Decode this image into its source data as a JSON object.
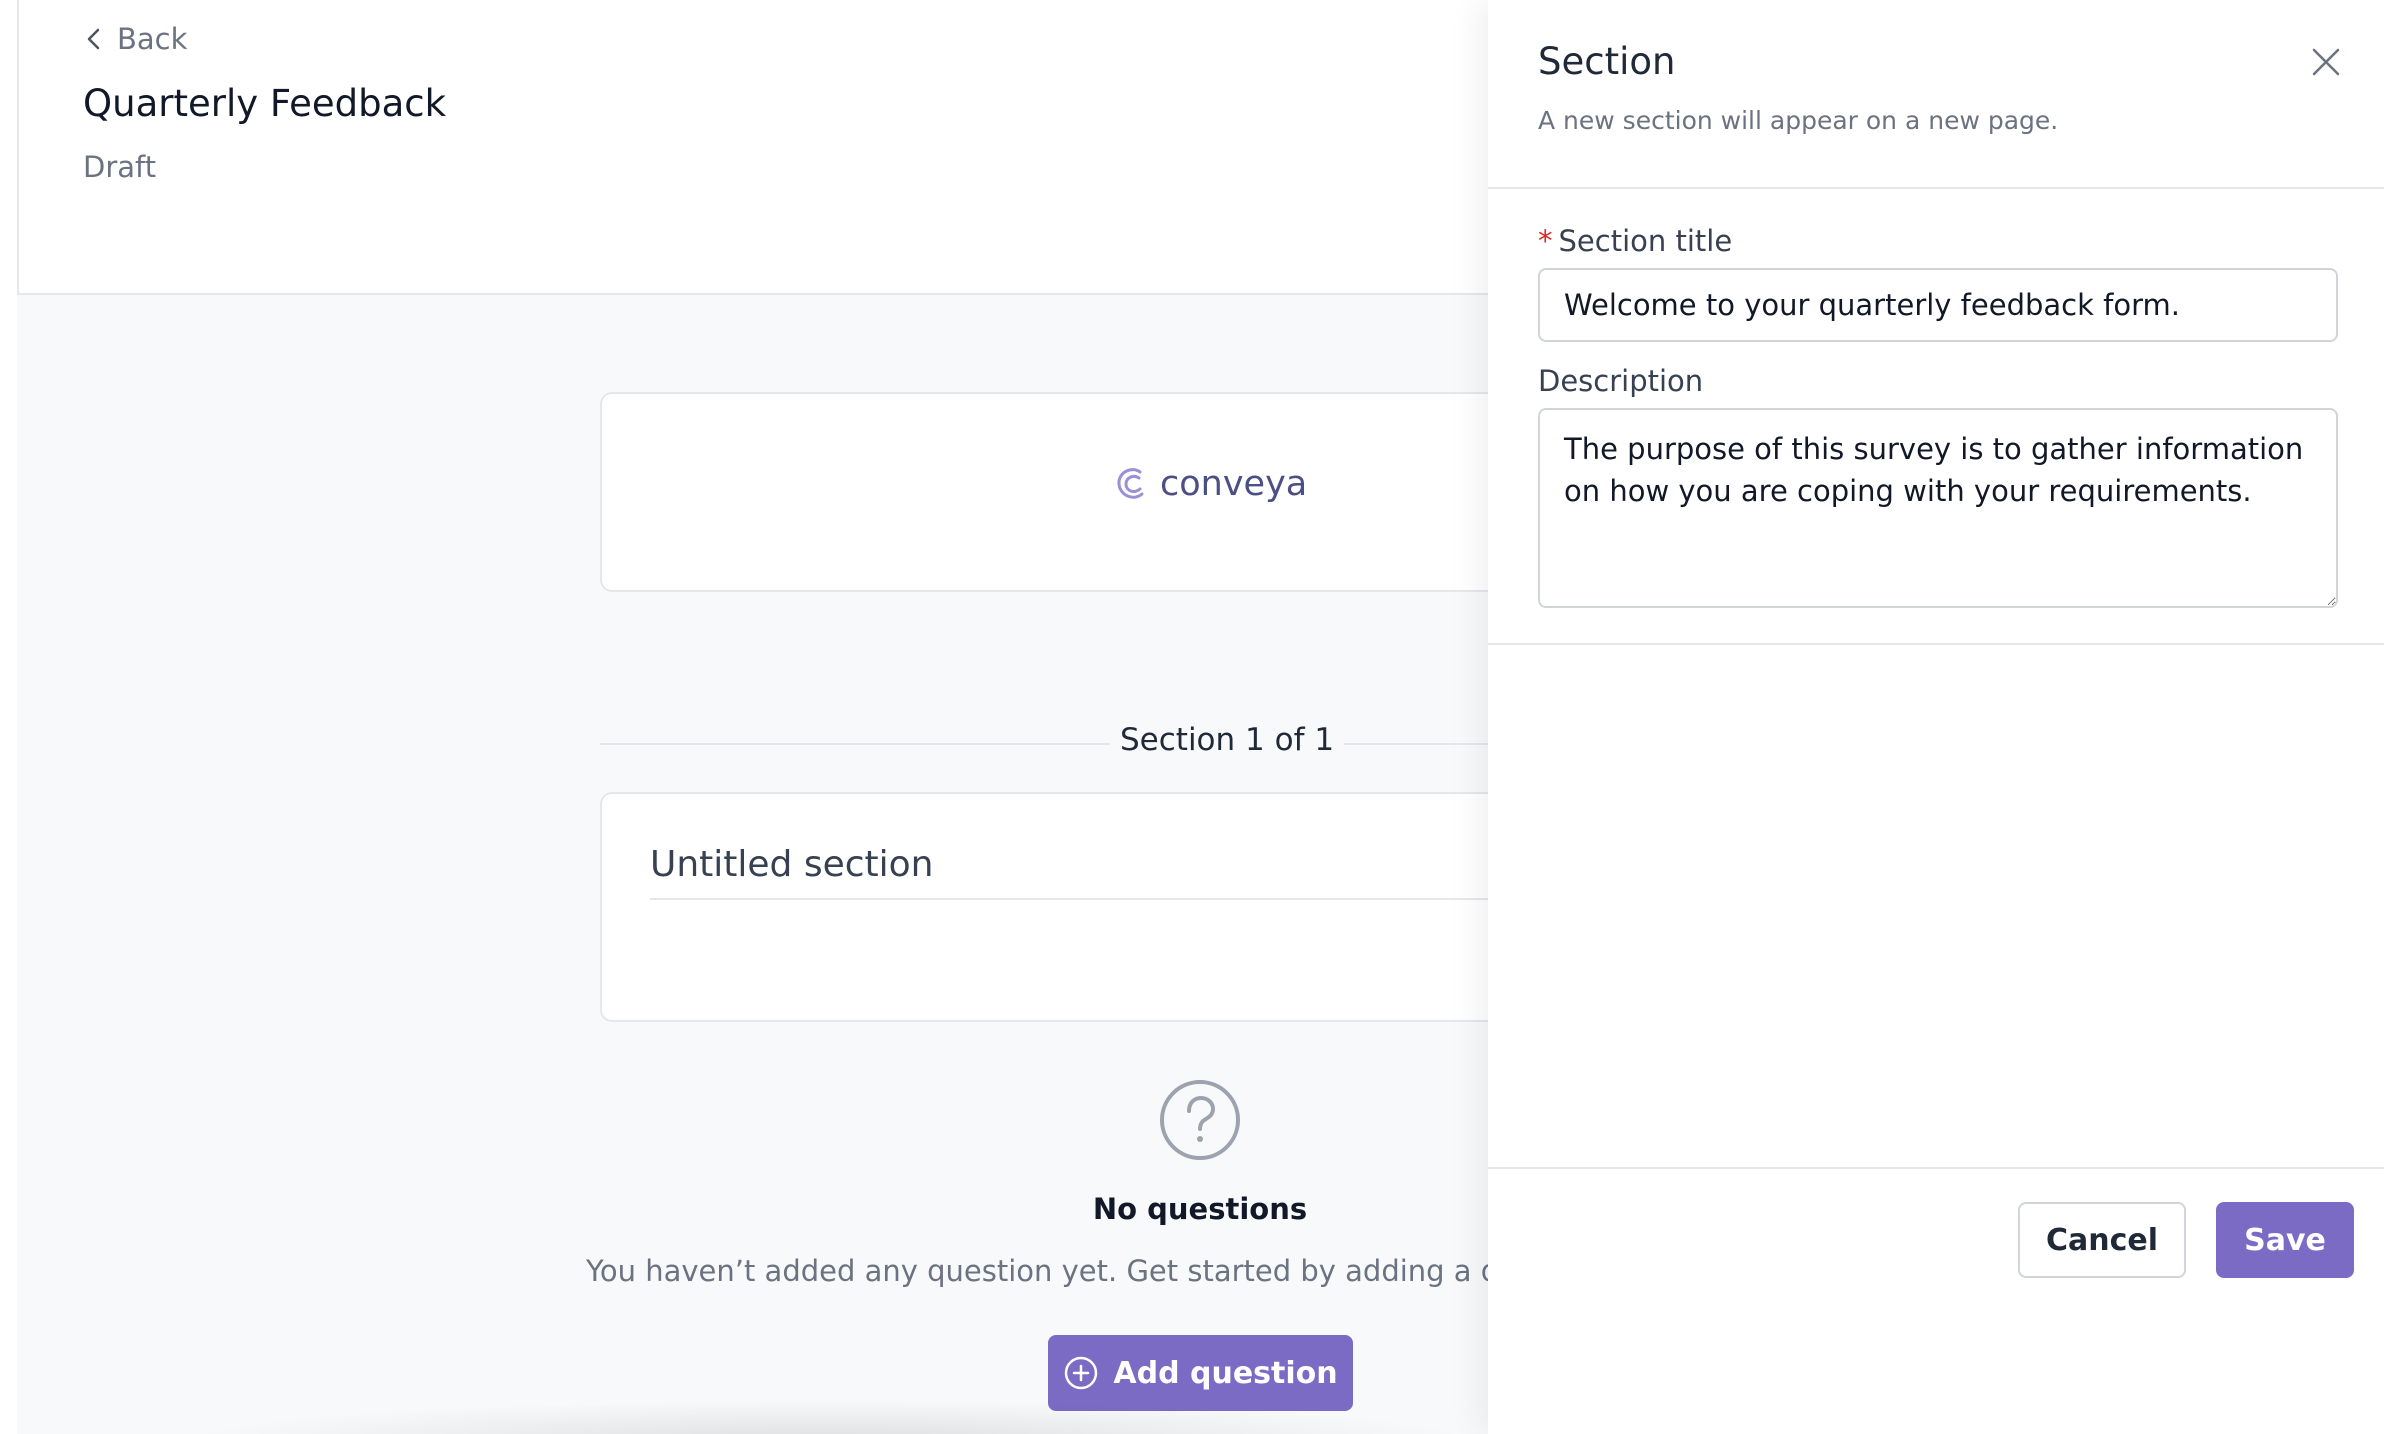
{
  "header": {
    "back_label": "Back",
    "title": "Quarterly Feedback",
    "status": "Draft"
  },
  "logo": {
    "brand": "conveya"
  },
  "section_divider": {
    "label": "Section 1 of 1"
  },
  "section_card": {
    "title": "Untitled section"
  },
  "empty_state": {
    "icon": "question-circle-icon",
    "title": "No questions",
    "text": "You haven’t added any question yet. Get started by adding a que"
  },
  "add_question_button": {
    "label": "Add question",
    "icon": "plus-circle-icon"
  },
  "drawer": {
    "title": "Section",
    "subtitle": "A new section will appear on a new page.",
    "section_title_label": "Section title",
    "required_marker": "*",
    "section_title_value": "Welcome to your quarterly feedback form.",
    "description_label": "Description",
    "description_value": "The purpose of this survey is to gather information on how you are coping with your requirements.",
    "cancel_label": "Cancel",
    "save_label": "Save"
  },
  "colors": {
    "accent": "#7c6bc4",
    "required": "#dc2626",
    "muted_text": "#6b7280",
    "background": "#f8f9fb"
  }
}
